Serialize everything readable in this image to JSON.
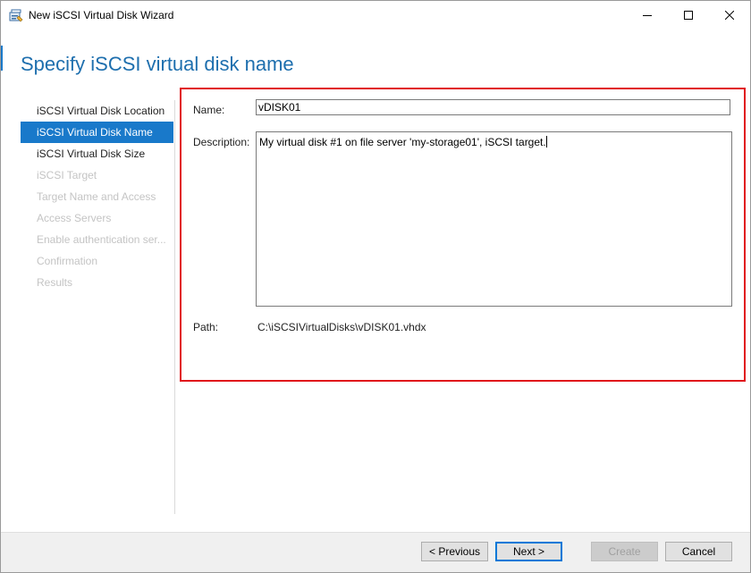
{
  "window": {
    "title": "New iSCSI Virtual Disk Wizard",
    "accent_color": "#1979ca",
    "highlight_color": "#e0151b"
  },
  "page": {
    "title": "Specify iSCSI virtual disk name"
  },
  "nav": {
    "items": [
      {
        "label": "iSCSI Virtual Disk Location",
        "state": "completed"
      },
      {
        "label": "iSCSI Virtual Disk Name",
        "state": "selected"
      },
      {
        "label": "iSCSI Virtual Disk Size",
        "state": "enabled"
      },
      {
        "label": "iSCSI Target",
        "state": "disabled"
      },
      {
        "label": "Target Name and Access",
        "state": "disabled"
      },
      {
        "label": "Access Servers",
        "state": "disabled"
      },
      {
        "label": "Enable authentication ser...",
        "state": "disabled"
      },
      {
        "label": "Confirmation",
        "state": "disabled"
      },
      {
        "label": "Results",
        "state": "disabled"
      }
    ]
  },
  "form": {
    "name_label": "Name:",
    "name_value": "vDISK01",
    "description_label": "Description:",
    "description_value": "My virtual disk #1 on file server 'my-storage01', iSCSI target.",
    "path_label": "Path:",
    "path_value": "C:\\iSCSIVirtualDisks\\vDISK01.vhdx"
  },
  "footer": {
    "previous_label": "< Previous",
    "next_label": "Next >",
    "create_label": "Create",
    "cancel_label": "Cancel"
  },
  "icons": {
    "app": "wizard-app-icon",
    "minimize": "minimize-icon",
    "maximize": "maximize-icon",
    "close": "close-icon"
  }
}
